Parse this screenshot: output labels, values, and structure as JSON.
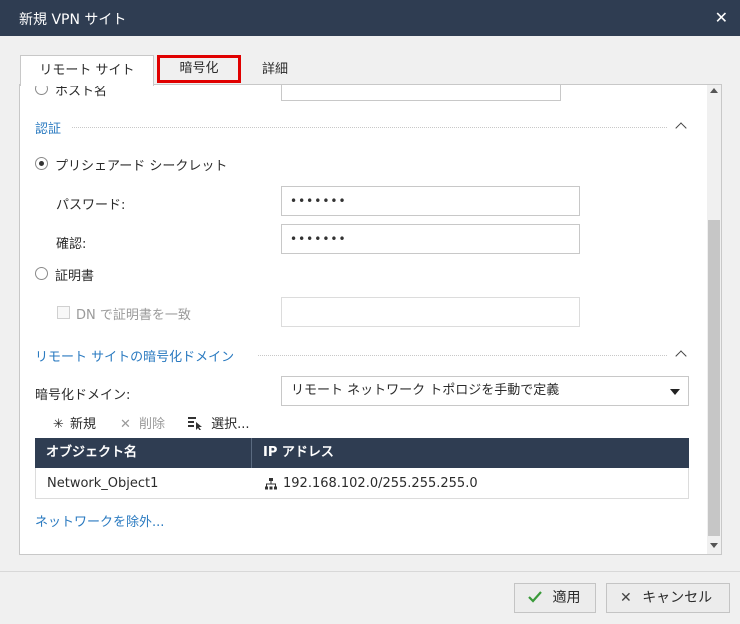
{
  "window": {
    "title": "新規 VPN サイト",
    "close_icon": "close-icon"
  },
  "tabs": [
    {
      "label": "リモート サイト",
      "active": true
    },
    {
      "label": "暗号化",
      "highlighted": true,
      "highlight_color": "#e00000"
    },
    {
      "label": "詳細"
    }
  ],
  "auth": {
    "hostname_label": "ホスト名",
    "section_title": "認証",
    "psk_label": "プリシェアード シークレット",
    "password_label": "パスワード:",
    "password_value": "•••••••",
    "confirm_label": "確認:",
    "confirm_value": "•••••••",
    "cert_label": "証明書",
    "dn_label": "DN で証明書を一致",
    "dn_value": ""
  },
  "encryption": {
    "section_title": "リモート サイトの暗号化ドメイン",
    "domain_label": "暗号化ドメイン:",
    "domain_value": "リモート ネットワーク トポロジを手動で定義",
    "toolbar": {
      "new_label": "新規",
      "delete_label": "削除",
      "select_label": "選択..."
    },
    "table": {
      "columns": [
        "オブジェクト名",
        "IP アドレス"
      ],
      "rows": [
        {
          "name": "Network_Object1",
          "ip": "192.168.102.0/255.255.255.0"
        }
      ]
    },
    "exclude_link": "ネットワークを除外..."
  },
  "footer": {
    "apply_label": "適用",
    "cancel_label": "キャンセル"
  },
  "colors": {
    "accent": "#2a7ac0",
    "titlebar": "#2f3d52",
    "highlight": "#e00000",
    "apply_check": "#3a9a3a"
  }
}
